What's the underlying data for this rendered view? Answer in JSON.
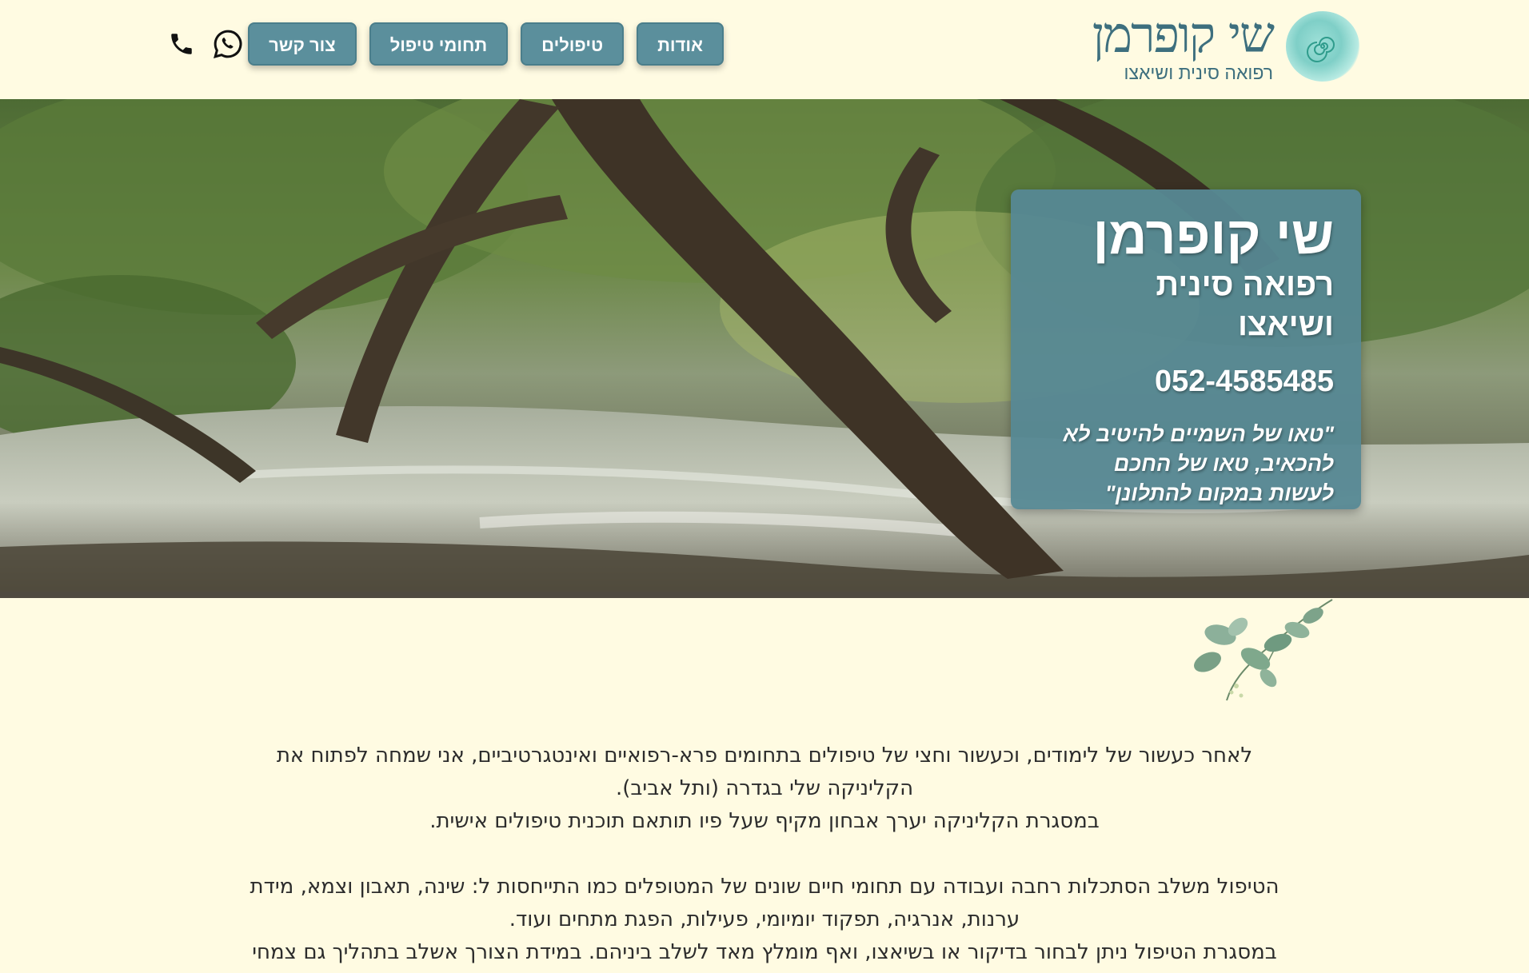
{
  "logo": {
    "name": "שי קופרמן",
    "subtitle": "רפואה סינית ושיאצו",
    "icon": "spiral-logo-icon"
  },
  "nav": {
    "items": [
      {
        "label": "אודות"
      },
      {
        "label": "טיפולים"
      },
      {
        "label": "תחומי טיפול"
      },
      {
        "label": "צור קשר"
      }
    ]
  },
  "contact_icons": [
    "whatsapp-icon",
    "phone-icon"
  ],
  "hero": {
    "name": "שי קופרמן",
    "subtitle_line1": "רפואה סינית",
    "subtitle_line2": "ושיאצו",
    "phone": "052-4585485",
    "quote_line1": "\"טאו של השמיים להיטיב לא",
    "quote_line2": "להכאיב, טאו של החכם",
    "quote_line3": "לעשות במקום להתלונן\""
  },
  "content": {
    "p1_line1": "לאחר כעשור של לימודים, וכעשור וחצי של טיפולים בתחומים פרא-רפואיים ואינטגרטיביים, אני שמחה לפתוח את",
    "p1_line2": "הקליניקה שלי בגדרה (ותל אביב).",
    "p1_line3": "במסגרת הקליניקה יערך אבחון מקיף שעל פיו תותאם תוכנית טיפולים אישית.",
    "p2_line1": "הטיפול משלב הסתכלות רחבה ועבודה עם תחומי חיים שונים של המטופלים כמו התייחסות ל: שינה, תאבון וצמא, מידת",
    "p2_line2": "ערנות, אנרגיה, תפקוד יומיומי, פעילות, הפגת מתחים ועוד.",
    "p2_line3": "במסגרת הטיפול ניתן לבחור בדיקור או בשיאצו, ואף מומלץ מאד לשלב ביניהם. במידת הצורך אשלב בתהליך גם צמחי"
  },
  "colors": {
    "background": "#fffbe2",
    "accent": "#5b8f9c",
    "brand_text": "#3d6f7e"
  }
}
